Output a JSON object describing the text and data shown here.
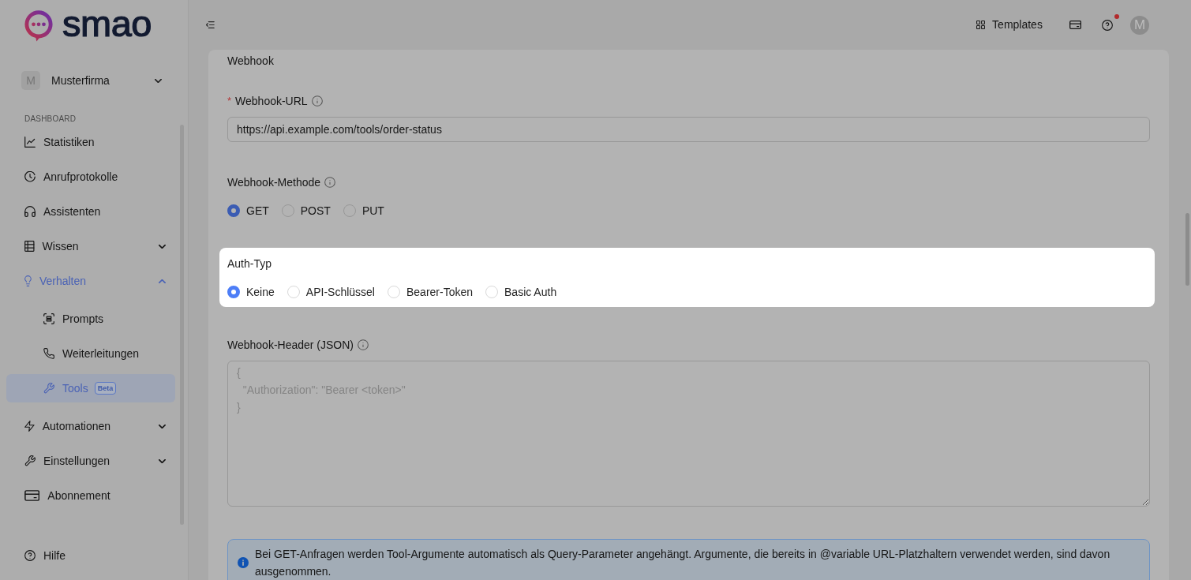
{
  "logo": {
    "text": "smao"
  },
  "workspace": {
    "initial": "M",
    "name": "Musterfirma"
  },
  "sidebar": {
    "section": "DASHBOARD",
    "items": [
      {
        "kind": "link",
        "label": "Statistiken",
        "selected": false
      },
      {
        "kind": "link",
        "label": "Anrufprotokolle",
        "selected": false
      },
      {
        "kind": "link",
        "label": "Assistenten",
        "selected": false
      },
      {
        "kind": "group",
        "label": "Wissen",
        "selected": false,
        "expanded": false
      },
      {
        "kind": "group",
        "label": "Verhalten",
        "selected": false,
        "expanded": true,
        "children": [
          {
            "label": "Prompts",
            "selected": false
          },
          {
            "label": "Weiterleitungen",
            "selected": false
          },
          {
            "label": "Tools",
            "selected": true,
            "badge": "Beta"
          }
        ]
      },
      {
        "kind": "group",
        "label": "Automationen",
        "selected": false,
        "expanded": false
      },
      {
        "kind": "group",
        "label": "Einstellungen",
        "selected": false,
        "expanded": false
      },
      {
        "kind": "link",
        "label": "Abonnement",
        "selected": false
      }
    ],
    "footer": {
      "label": "Hilfe"
    }
  },
  "header": {
    "templates_button": "Templates",
    "help_notification": true,
    "avatar_initial": "M"
  },
  "form": {
    "title": "Webhook",
    "fields": [
      {
        "kind": "text",
        "label": "Webhook-URL",
        "required_mark": "*",
        "info": true,
        "highlighted": false,
        "value": "https://api.example.com/tools/order-status"
      },
      {
        "kind": "radio",
        "label": "Webhook-Methode",
        "info": true,
        "highlighted": false,
        "options": [
          {
            "label": "GET",
            "selected": true
          },
          {
            "label": "POST",
            "selected": false
          },
          {
            "label": "PUT",
            "selected": false
          }
        ]
      },
      {
        "kind": "radio",
        "label": "Auth-Typ",
        "info": false,
        "highlighted": true,
        "options": [
          {
            "label": "Keine",
            "selected": true
          },
          {
            "label": "API-Schlüssel",
            "selected": false
          },
          {
            "label": "Bearer-Token",
            "selected": false
          },
          {
            "label": "Basic Auth",
            "selected": false
          }
        ]
      },
      {
        "kind": "textarea",
        "label": "Webhook-Header (JSON)",
        "info": true,
        "highlighted": false,
        "placeholder": "{\n  \"Authorization\": \"Bearer <token>\"\n}"
      }
    ],
    "note": "Bei GET-Anfragen werden Tool-Argumente automatisch als Query-Parameter angehängt. Argumente, die bereits in @variable URL-Platzhaltern verwendet werden, sind davon ausgenommen."
  }
}
